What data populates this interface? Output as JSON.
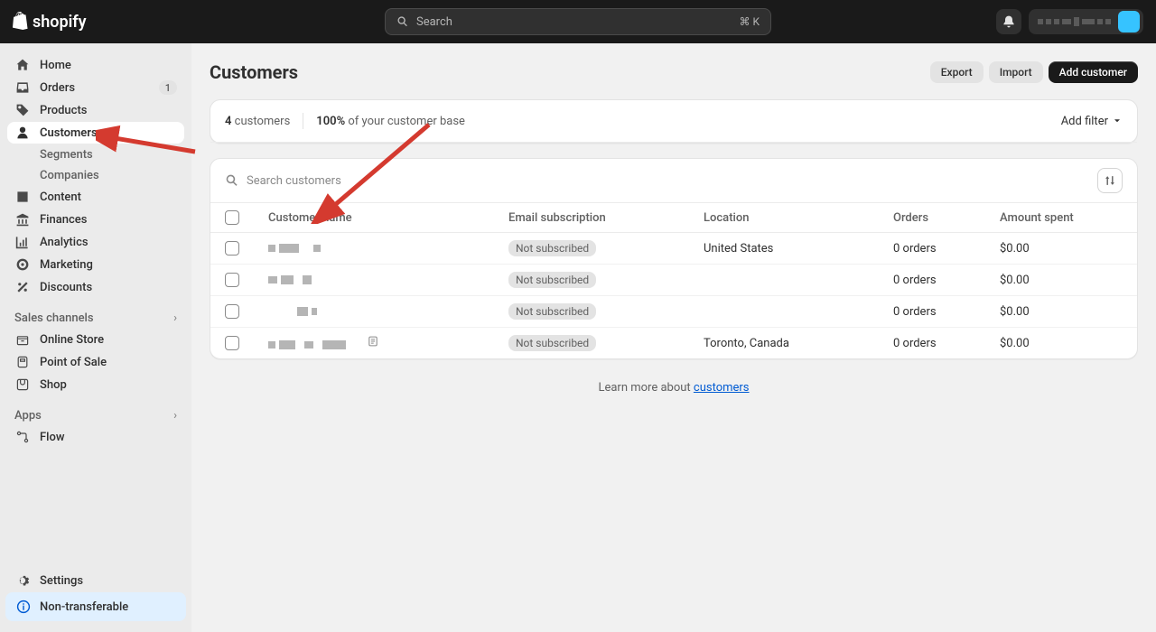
{
  "topbar": {
    "brand": "shopify",
    "search_placeholder": "Search",
    "search_shortcut": "⌘ K"
  },
  "nav": {
    "home": "Home",
    "orders": "Orders",
    "orders_badge": "1",
    "products": "Products",
    "customers": "Customers",
    "segments": "Segments",
    "companies": "Companies",
    "content": "Content",
    "finances": "Finances",
    "analytics": "Analytics",
    "marketing": "Marketing",
    "discounts": "Discounts",
    "sales_channels": "Sales channels",
    "online_store": "Online Store",
    "point_of_sale": "Point of Sale",
    "shop": "Shop",
    "apps": "Apps",
    "flow": "Flow",
    "settings": "Settings",
    "non_transferable": "Non-transferable"
  },
  "page": {
    "title": "Customers",
    "export": "Export",
    "import": "Import",
    "add_customer": "Add customer",
    "stat1_value": "4",
    "stat1_label": " customers",
    "stat2_value": "100%",
    "stat2_label": " of your customer base",
    "add_filter": "Add filter",
    "search_placeholder": "Search customers"
  },
  "table": {
    "headers": {
      "name": "Customer name",
      "subscription": "Email subscription",
      "location": "Location",
      "orders": "Orders",
      "amount": "Amount spent"
    },
    "rows": [
      {
        "subscription": "Not subscribed",
        "location": "United States",
        "orders": "0 orders",
        "amount": "$0.00",
        "has_note": false
      },
      {
        "subscription": "Not subscribed",
        "location": "",
        "orders": "0 orders",
        "amount": "$0.00",
        "has_note": false
      },
      {
        "subscription": "Not subscribed",
        "location": "",
        "orders": "0 orders",
        "amount": "$0.00",
        "has_note": false
      },
      {
        "subscription": "Not subscribed",
        "location": "Toronto, Canada",
        "orders": "0 orders",
        "amount": "$0.00",
        "has_note": true
      }
    ]
  },
  "footer": {
    "learn_prefix": "Learn more about ",
    "learn_link": "customers"
  }
}
